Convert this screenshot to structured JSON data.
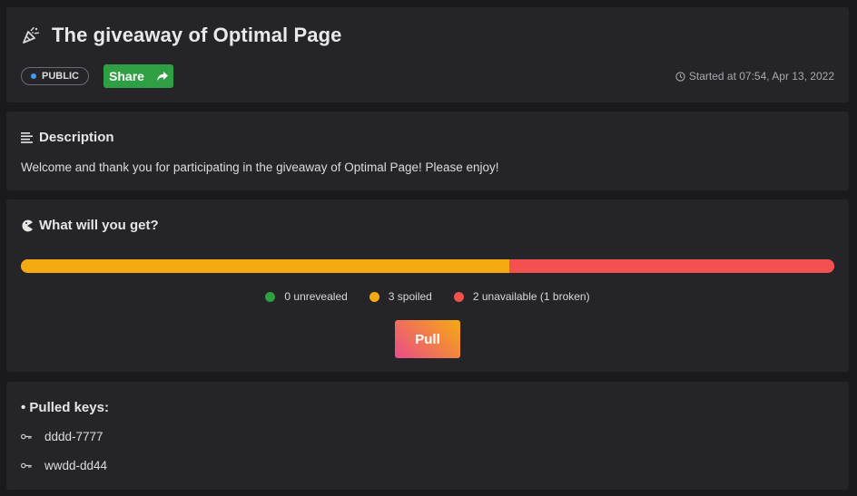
{
  "header": {
    "title": "The giveaway of Optimal Page",
    "title_icon": "party-popper-icon",
    "badge": "PUBLIC",
    "share_label": "Share",
    "started": "Started at 07:54, Apr 13, 2022"
  },
  "description": {
    "title": "Description",
    "text": "Welcome and thank you for participating in the giveaway of Optimal Page! Please enjoy!"
  },
  "prize": {
    "title": "What will you get?",
    "progress": {
      "unrevealed": 0,
      "spoiled": 3,
      "unavailable": 2
    },
    "legend": [
      {
        "label": "0 unrevealed",
        "color": "#2ea043"
      },
      {
        "label": "3 spoiled",
        "color": "#f6aa11"
      },
      {
        "label": "2 unavailable (1 broken)",
        "color": "#f35050"
      }
    ],
    "pull_label": "Pull"
  },
  "keys": {
    "title": "• Pulled keys:",
    "items": [
      "dddd-7777",
      "wwdd-dd44"
    ]
  },
  "colors": {
    "background": "#1a1a1d",
    "card": "#252529",
    "share": "#2ea043",
    "badge_dot": "#3f9cf2"
  }
}
